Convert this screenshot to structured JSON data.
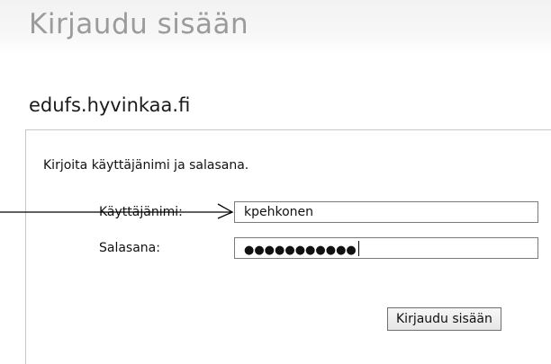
{
  "page": {
    "title": "Kirjaudu sisään",
    "server": "edufs.hyvinkaa.fi"
  },
  "form": {
    "instructions": "Kirjoita käyttäjänimi ja salasana.",
    "username_label": "Käyttäjänimi:",
    "username_value": "kpehkonen",
    "password_label": "Salasana:",
    "password_masked": "●●●●●●●●●●●",
    "submit_label": "Kirjaudu sisään"
  },
  "annotation": {
    "arrow_target": "username-field"
  }
}
